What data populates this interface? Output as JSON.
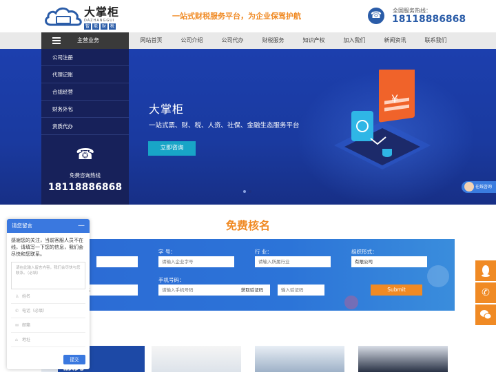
{
  "header": {
    "logo_cn": "大掌柜",
    "logo_en": "DAZHANGGUI",
    "logo_tags": [
      "智",
      "能",
      "财",
      "税"
    ],
    "slogan": "一站式财税服务平台，为企业保驾护航",
    "hotline_label": "全国服务热线：",
    "hotline_number": "18118886868"
  },
  "nav": {
    "main_label": "主营业务",
    "items": [
      "网站首页",
      "公司介绍",
      "公司代办",
      "财税服务",
      "知识产权",
      "加入我们",
      "新闻资讯",
      "联系我们"
    ]
  },
  "side_menu": {
    "items": [
      "公司注册",
      "代理记账",
      "合规经营",
      "财务外包",
      "资质代办"
    ],
    "phone_label": "免费咨询热线",
    "phone_number": "18118886868"
  },
  "banner": {
    "title": "大掌柜",
    "subtitle": "一站式票、财、税、人资、社保、金融生态服务平台",
    "button": "立即咨询",
    "online_chat": "在线咨询"
  },
  "name_check": {
    "title": "免费核名",
    "zihao_label": "字 号：",
    "zihao_placeholder": "请输入企业字号",
    "hangye_label": "行 业：",
    "hangye_placeholder": "请输入所属行业",
    "zuzhi_label": "组织形式：",
    "zuzhi_value": "有限公司",
    "name_placeholder": "名",
    "phone_label": "手机号码：",
    "phone_placeholder": "请输入手机号码",
    "code_button": "获取验证码",
    "code_placeholder": "输入验证码",
    "submit": "Submit"
  },
  "cards": {
    "first_text": "服务"
  },
  "message": {
    "title": "请您留言",
    "minimize": "—",
    "intro": "感谢您的关注，当前客服人员不在线，请填写一下您的信息，我们会尽快和您联系。",
    "textarea_placeholder": "请在此输入留言内容，我们会尽快与您联系。（必填）",
    "fields": [
      "姓名",
      "电话（必填）",
      "邮箱",
      "地址"
    ],
    "submit": "提交"
  },
  "colors": {
    "brand_blue": "#2a5ca8",
    "accent_orange": "#f08a24",
    "banner_blue": "#1c3fae"
  }
}
